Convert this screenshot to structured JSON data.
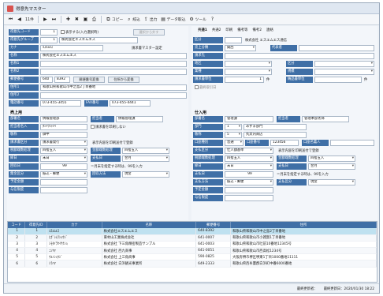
{
  "window": {
    "title": "得意先マスター"
  },
  "toolbar": {
    "items": [
      {
        "icon": "first-icon",
        "glyph": "⏮",
        "label": ""
      },
      {
        "icon": "prev-icon",
        "glyph": "◀",
        "label": ""
      },
      {
        "icon": "record-count",
        "glyph": "",
        "label": "11件"
      },
      {
        "icon": "next-icon",
        "glyph": "▶",
        "label": ""
      },
      {
        "icon": "last-icon",
        "glyph": "⏭",
        "label": ""
      },
      {
        "icon": "new-icon",
        "glyph": "✚",
        "label": ""
      },
      {
        "icon": "delete-icon",
        "glyph": "✖",
        "label": ""
      },
      {
        "icon": "save-icon",
        "glyph": "▣",
        "label": ""
      },
      {
        "icon": "print-icon",
        "glyph": "⎙",
        "label": ""
      },
      {
        "icon": "copy-icon",
        "glyph": "⧉",
        "label": "コピー"
      },
      {
        "icon": "search-icon",
        "glyph": "⌕",
        "label": "絞込"
      },
      {
        "icon": "export-icon",
        "glyph": "⇪",
        "label": "出力"
      },
      {
        "icon": "data-icon",
        "glyph": "▤",
        "label": "データ取込"
      },
      {
        "icon": "tool-icon",
        "glyph": "⚙",
        "label": "ツール"
      },
      {
        "icon": "help-icon",
        "glyph": "?",
        "label": ""
      }
    ]
  },
  "left": {
    "code_label": "得意先コード",
    "code_value": "1",
    "chk_display": "表示する(入力選択時)",
    "btn_inactive": "選択から外す",
    "group_label": "得意先グループ",
    "group_value": "1",
    "group_name": "株式会社エスエムエス",
    "kana_label": "カナ",
    "kana_value": "ｴｽｴﾑｴｽ",
    "kana_note": "請求書マスター設定",
    "name_label": "名称",
    "name_value": "株式会社エスエムエス",
    "name1_label": "名称1",
    "name1_value": "",
    "name2_label": "名称2",
    "name2_value": "",
    "zip_label": "郵便番号",
    "zip_value1": "640",
    "zip_value2": "8392",
    "btn_zip": "郵便番号変換",
    "btn_addr": "住所から変換",
    "addr1_label": "住所1",
    "addr1_value": "和歌山県和歌山市中之島2丁目番地",
    "addr2_label": "住所2",
    "addr2_value": "",
    "tel_label": "電話番号",
    "tel_value": "073-455-3455",
    "fax_label": "FAX番号",
    "fax_value": "073-455-4441",
    "sales_head": "売上用",
    "dept_label": "部署名",
    "dept_value": "情報管理部",
    "person_label": "担当者",
    "person_value": "情報管理課",
    "rep_label": "担当者名入",
    "rep_value": "ﾀﾝﾄｳｼｬﾒｲ",
    "chk_print": "請求書を印刷しない",
    "title_label": "敬称",
    "title_value": "御中",
    "closing_label": "請求書区分",
    "closing_value": "請求書発行",
    "closing_note": "表示内容を印刷送付で登録",
    "round1_label": "税額端数処理",
    "round1_value": "四捨五入",
    "round2_label": "金額端数処理",
    "round2_value": "四捨五入",
    "cut_label": "締日",
    "cut_value": "末日",
    "pay_label": "支払日",
    "pay_value": "翌月",
    "payday_label": "回収日",
    "payday_value": "99",
    "payday_note": "＝月末を指定する時は、99を入力",
    "collect_label": "集金区分",
    "collect_value": "振込・郵便",
    "collect2_label": "回収方法",
    "collect2_value": "現金",
    "memo1_label": "予定金額",
    "memo1_value": "",
    "memo2_label": "与信限度",
    "memo2_value": ""
  },
  "right": {
    "tabs": [
      "共通1",
      "共通2",
      "印刷",
      "備考等",
      "備考2",
      "連絡"
    ],
    "r1_label": "区分",
    "r1_value": "",
    "r1_name": "株式会社 エスエムエス通信",
    "r2_label": "売上分類",
    "r2_value": "関西",
    "r2_name_label": "代表者",
    "r2_name_value": "",
    "r3_label": "請求先",
    "r3_value": "",
    "r4_label": "地区",
    "r4_value": "",
    "r4b_label": "区分",
    "r4b_value": "",
    "r5_label": "業種",
    "r5_value": "",
    "r5b_label": "規模",
    "r5b_value": "",
    "r6_label": "請求書単位",
    "r6_value": "1",
    "r6_unit": "件",
    "r6b_label": "納品書単位",
    "r6b_unit": "件",
    "chk_flag": "最終取引日",
    "buy_head": "仕入用",
    "b_dept_label": "部署名",
    "b_dept_value": "管理課",
    "b_person_label": "担当者",
    "b_person_value": "管理本部太郎",
    "b_rep_label": "部門",
    "b_rep_value": "1",
    "b_rep_name": "あずま部門",
    "b_title_label": "敬称",
    "b_title_value": "5",
    "b_title_name": "丸太内商店",
    "b_bank_label": "口座種別",
    "b_bank_value": "普通",
    "b_acct_label": "口座番号",
    "b_acct_value": "123456",
    "b_acctname_label": "口座名義人",
    "b_acctname_value": "",
    "b_closing_label": "支払区分",
    "b_closing_value": "仕入額基準",
    "b_closing_note": "表示内容を印刷送付で登録",
    "b_round1_label": "税額端数処理",
    "b_round1_value": "四捨五入",
    "b_round2_label": "金額端数処理",
    "b_round2_value": "四捨五入",
    "b_cut_label": "締日",
    "b_cut_value": "末日",
    "b_pay_label": "支払日",
    "b_pay_value": "翌月",
    "b_payday_label": "支払日",
    "b_payday_value": "99",
    "b_payday_note": "＝月末を指定する時は、99を入力",
    "b_collect_label": "支払方法",
    "b_collect_value": "振込・郵便",
    "b_collect2_label": "支払区分",
    "b_collect2_value": "現金",
    "b_memo1_label": "予定金額",
    "b_memo1_value": "",
    "b_memo2_label": "与信限度",
    "b_memo2_value": ""
  },
  "grid": {
    "headers": [
      "コード",
      "得意先ID",
      "カナ",
      "名称",
      "郵便番号",
      "住所"
    ],
    "rows": [
      [
        "1",
        "1",
        "ｴｽｴﾑｴｽ",
        "株式会社エスエムエス",
        "640-8392",
        "和歌山県和歌山市中之島2丁目番地"
      ],
      [
        "2",
        "2",
        "ﾋｶﾞｼﾑﾗｼｮｳｼﾞ",
        "東村山工業株式会社",
        "641-0007",
        "和歌山県和歌山市小雑賀1丁目番地"
      ],
      [
        "3",
        "3",
        "ｼﾓﾀｲﾗｾｲｻｸｼｮ",
        "株式会社 下三角精密製造サンプル",
        "641-0003",
        "和歌山県和歌山市吐前10番地12345号"
      ],
      [
        "4",
        "4",
        "ﾆｼﾔﾏ",
        "株式会社 西九商事",
        "641-0051",
        "和歌山県和歌山市西高松1234号"
      ],
      [
        "5",
        "5",
        "ｳｴﾉｼｮｳｼﾞ",
        "株式会社 上三角商事",
        "590-0825",
        "大阪府堺市堺区堺東1丁目1000番地11111"
      ],
      [
        "6",
        "6",
        "ｼﾗﾊﾏ",
        "株式会社 白浜観光事業所",
        "649-2333",
        "和歌山県西牟婁郡白浜町中番6000番地"
      ]
    ]
  },
  "status": {
    "left": "最終更新者：",
    "right": "最終更新日：2020/01/30 18:22"
  }
}
